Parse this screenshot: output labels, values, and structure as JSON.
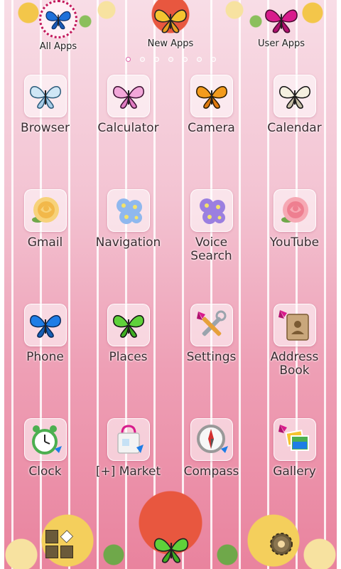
{
  "header": {
    "all_apps": "All Apps",
    "new_apps": "New Apps",
    "user_apps": "User Apps"
  },
  "pager": {
    "count": 7,
    "active": 0
  },
  "apps": [
    {
      "label": "Browser",
      "icon": "blue-white-butterfly-icon"
    },
    {
      "label": "Calculator",
      "icon": "pink-swallowtail-butterfly-icon"
    },
    {
      "label": "Camera",
      "icon": "orange-butterfly-icon"
    },
    {
      "label": "Calendar",
      "icon": "black-white-swallowtail-icon"
    },
    {
      "label": "Gmail",
      "icon": "yellow-rose-icon"
    },
    {
      "label": "Navigation",
      "icon": "blue-flowers-icon"
    },
    {
      "label": "Voice\nSearch",
      "icon": "purple-flowers-icon"
    },
    {
      "label": "YouTube",
      "icon": "pink-rose-icon"
    },
    {
      "label": "Phone",
      "icon": "blue-morpho-butterfly-icon"
    },
    {
      "label": "Places",
      "icon": "green-butterfly-icon"
    },
    {
      "label": "Settings",
      "icon": "tools-butterfly-icon"
    },
    {
      "label": "Address\nBook",
      "icon": "address-book-butterfly-icon"
    },
    {
      "label": "Clock",
      "icon": "alarm-clock-icon"
    },
    {
      "label": "[+] Market",
      "icon": "shopping-bag-icon"
    },
    {
      "label": "Compass",
      "icon": "compass-icon"
    },
    {
      "label": "Gallery",
      "icon": "photos-butterfly-icon"
    }
  ],
  "dock": {
    "left_icon": "app-drawer-grid-icon",
    "center_icon": "green-butterfly-icon",
    "right_icon": "gear-icon"
  },
  "colors": {
    "background_top": "#f8dde6",
    "background_bottom": "#e9839e",
    "label_text": "#3a2a30"
  }
}
